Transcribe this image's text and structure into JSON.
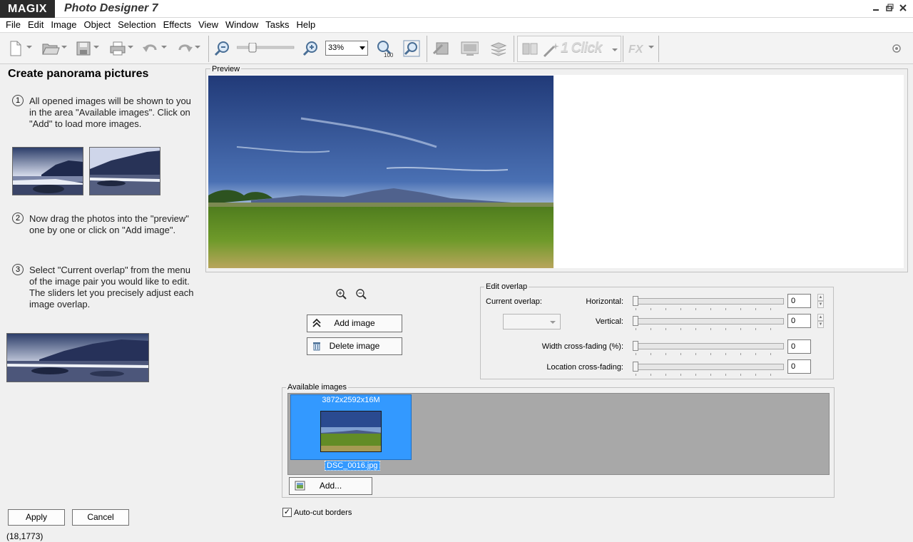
{
  "window": {
    "brand": "MAGIX",
    "title": "Photo Designer 7",
    "controls": [
      "minimize",
      "restore",
      "close"
    ]
  },
  "menu": [
    "File",
    "Edit",
    "Image",
    "Object",
    "Selection",
    "Effects",
    "View",
    "Window",
    "Tasks",
    "Help"
  ],
  "toolbar": {
    "zoom_value": "33%",
    "zoom_options_selected": "33%",
    "one_click_label": "1 Click",
    "icons": [
      "new-file-icon",
      "open-folder-icon",
      "save-icon",
      "print-icon",
      "undo-icon",
      "redo-icon",
      "zoom-out-icon",
      "zoom-in-icon",
      "zoom-100-icon",
      "zoom-fit-icon",
      "adjust-icon",
      "display-icon",
      "layers-icon",
      "compare-icon",
      "magic-wand-icon",
      "fx-icon",
      "help-icon"
    ]
  },
  "left_panel": {
    "title": "Create panorama pictures",
    "steps": [
      {
        "num": "1",
        "text": "All opened images will be shown to you in the area \"Available images\". Click on \"Add\" to load more images."
      },
      {
        "num": "2",
        "text": "Now drag the photos into the \"preview\" one by one or click on \"Add image\"."
      },
      {
        "num": "3",
        "text": "Select \"Current overlap\" from the menu of the image pair you would like to edit. The sliders let you precisely adjust each image overlap."
      }
    ],
    "apply_label": "Apply",
    "cancel_label": "Cancel"
  },
  "status": "(18,1773)",
  "preview": {
    "legend": "Preview"
  },
  "actions": {
    "add_image_label": "Add image",
    "delete_image_label": "Delete image"
  },
  "edit_overlap": {
    "legend": "Edit overlap",
    "current_overlap_label": "Current overlap:",
    "current_overlap_value": "",
    "horizontal_label": "Horizontal:",
    "horizontal_value": "0",
    "vertical_label": "Vertical:",
    "vertical_value": "0",
    "width_crossfade_label": "Width cross-fading (%):",
    "width_crossfade_value": "0",
    "location_crossfade_label": "Location cross-fading:",
    "location_crossfade_value": "0"
  },
  "available_images": {
    "legend": "Available images",
    "items": [
      {
        "dimensions": "3872x2592x16M",
        "filename": "DSC_0016.jpg"
      }
    ],
    "add_label": "Add..."
  },
  "autocut": {
    "label": "Auto-cut borders",
    "checked": true
  },
  "colors": {
    "brand_bg": "#2b2b2b",
    "selection": "#3399ff",
    "available_bg": "#a8a8a8"
  }
}
